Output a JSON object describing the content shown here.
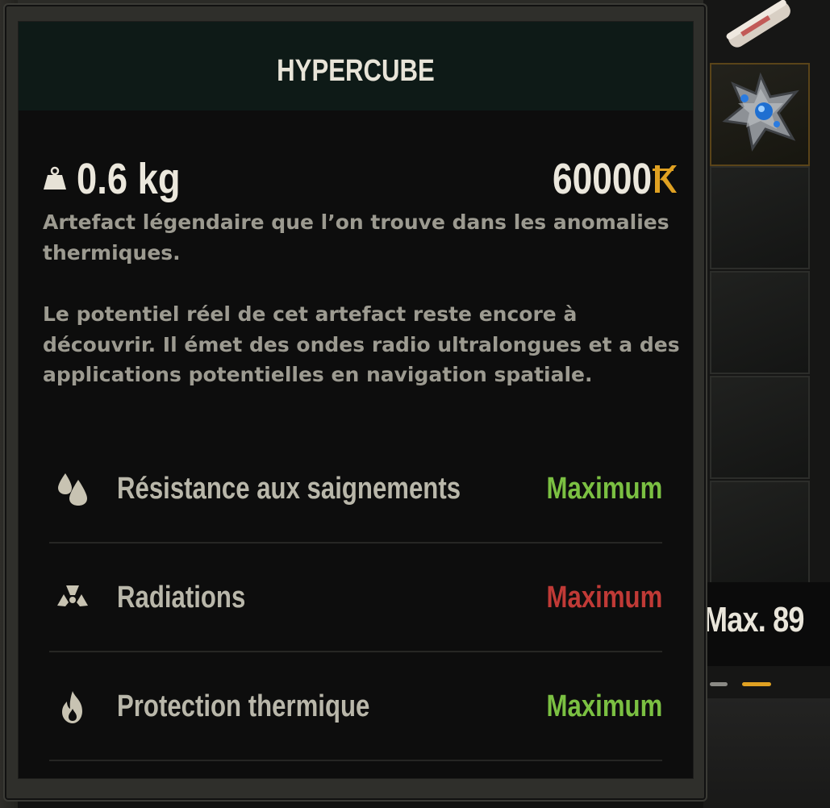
{
  "tooltip": {
    "title": "HYPERCUBE",
    "weight": "0.6 kg",
    "price": "60000",
    "description": [
      "Artefact légendaire que l’on trouve dans les anomalies thermiques.",
      "Le potentiel réel de cet artefact reste encore à découvrir. Il émet des ondes radio ultralongues et a des applications potentielles en navigation spatiale."
    ],
    "effects": [
      {
        "name": "Résistance aux saignements",
        "value": "Maximum",
        "icon": "bleeding-drops-icon",
        "value_color": "#7bc042"
      },
      {
        "name": "Radiations",
        "value": "Maximum",
        "icon": "radiation-icon",
        "value_color": "#c03a36"
      },
      {
        "name": "Protection thermique",
        "value": "Maximum",
        "icon": "flame-icon",
        "value_color": "#7bc042"
      }
    ]
  },
  "inventory": {
    "limit_text": "Max. 89"
  },
  "colors": {
    "accent_gold": "#e0a122",
    "positive": "#7bc042",
    "negative": "#c03a36"
  }
}
